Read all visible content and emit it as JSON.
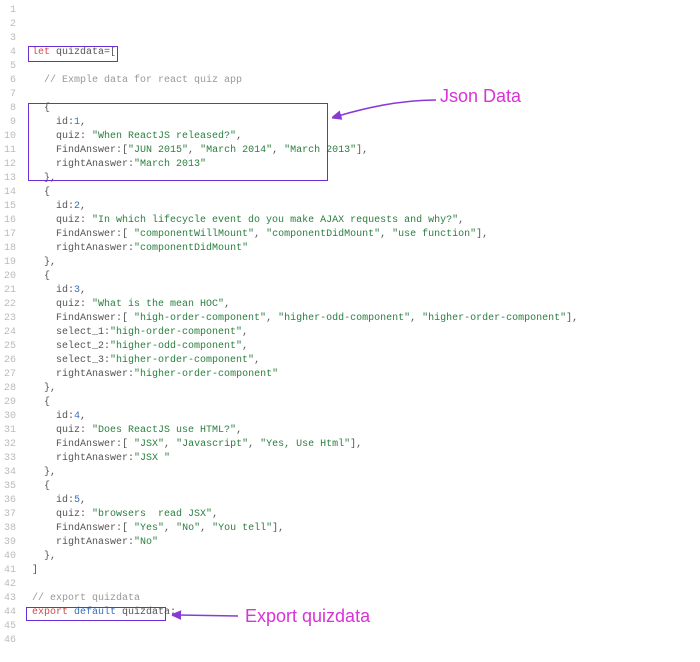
{
  "annotations": {
    "json_data": "Json Data",
    "export_quizdata": "Export quizdata"
  },
  "lines": [
    {
      "n": 1,
      "tokens": []
    },
    {
      "n": 2,
      "tokens": []
    },
    {
      "n": 3,
      "tokens": []
    },
    {
      "n": 4,
      "tokens": [
        [
          "kw-let",
          " let "
        ],
        [
          "ident",
          "quizdata"
        ],
        [
          "punct",
          "=["
        ]
      ]
    },
    {
      "n": 5,
      "tokens": []
    },
    {
      "n": 6,
      "tokens": [
        [
          "comment",
          "   // Exmple data for react quiz app"
        ]
      ]
    },
    {
      "n": 7,
      "tokens": []
    },
    {
      "n": 8,
      "tokens": [
        [
          "punct",
          "   {"
        ]
      ]
    },
    {
      "n": 9,
      "tokens": [
        [
          "prop",
          "     id"
        ],
        [
          "punct",
          ":"
        ],
        [
          "num",
          "1"
        ],
        [
          "punct",
          ","
        ]
      ]
    },
    {
      "n": 10,
      "tokens": [
        [
          "prop",
          "     quiz"
        ],
        [
          "punct",
          ": "
        ],
        [
          "str",
          "\"When ReactJS released?\""
        ],
        [
          "punct",
          ","
        ]
      ]
    },
    {
      "n": 11,
      "tokens": [
        [
          "prop",
          "     FindAnswer"
        ],
        [
          "punct",
          ":["
        ],
        [
          "str",
          "\"JUN 2015\""
        ],
        [
          "punct",
          ", "
        ],
        [
          "str",
          "\"March 2014\""
        ],
        [
          "punct",
          ", "
        ],
        [
          "str",
          "\"March 2013\""
        ],
        [
          "punct",
          "],"
        ]
      ]
    },
    {
      "n": 12,
      "tokens": [
        [
          "prop",
          "     rightAnaswer"
        ],
        [
          "punct",
          ":"
        ],
        [
          "str",
          "\"March 2013\""
        ]
      ]
    },
    {
      "n": 13,
      "tokens": [
        [
          "punct",
          "   },"
        ]
      ]
    },
    {
      "n": 14,
      "tokens": [
        [
          "punct",
          "   {"
        ]
      ]
    },
    {
      "n": 15,
      "tokens": [
        [
          "prop",
          "     id"
        ],
        [
          "punct",
          ":"
        ],
        [
          "num",
          "2"
        ],
        [
          "punct",
          ","
        ]
      ]
    },
    {
      "n": 16,
      "tokens": [
        [
          "prop",
          "     quiz"
        ],
        [
          "punct",
          ": "
        ],
        [
          "str",
          "\"In which lifecycle event do you make AJAX requests and why?\""
        ],
        [
          "punct",
          ","
        ]
      ]
    },
    {
      "n": 17,
      "tokens": [
        [
          "prop",
          "     FindAnswer"
        ],
        [
          "punct",
          ":[ "
        ],
        [
          "str",
          "\"componentWillMount\""
        ],
        [
          "punct",
          ", "
        ],
        [
          "str",
          "\"componentDidMount\""
        ],
        [
          "punct",
          ", "
        ],
        [
          "str",
          "\"use function\""
        ],
        [
          "punct",
          "],"
        ]
      ]
    },
    {
      "n": 18,
      "tokens": [
        [
          "prop",
          "     rightAnaswer"
        ],
        [
          "punct",
          ":"
        ],
        [
          "str",
          "\"componentDidMount\""
        ]
      ]
    },
    {
      "n": 19,
      "tokens": [
        [
          "punct",
          "   },"
        ]
      ]
    },
    {
      "n": 20,
      "tokens": [
        [
          "punct",
          "   {"
        ]
      ]
    },
    {
      "n": 21,
      "tokens": [
        [
          "prop",
          "     id"
        ],
        [
          "punct",
          ":"
        ],
        [
          "num",
          "3"
        ],
        [
          "punct",
          ","
        ]
      ]
    },
    {
      "n": 22,
      "tokens": [
        [
          "prop",
          "     quiz"
        ],
        [
          "punct",
          ": "
        ],
        [
          "str",
          "\"What is the mean HOC\""
        ],
        [
          "punct",
          ","
        ]
      ]
    },
    {
      "n": 23,
      "tokens": [
        [
          "prop",
          "     FindAnswer"
        ],
        [
          "punct",
          ":[ "
        ],
        [
          "str",
          "\"high-order-component\""
        ],
        [
          "punct",
          ", "
        ],
        [
          "str",
          "\"higher-odd-component\""
        ],
        [
          "punct",
          ", "
        ],
        [
          "str",
          "\"higher-order-component\""
        ],
        [
          "punct",
          "],"
        ]
      ]
    },
    {
      "n": 24,
      "tokens": [
        [
          "prop",
          "     select_1"
        ],
        [
          "punct",
          ":"
        ],
        [
          "str",
          "\"high-order-component\""
        ],
        [
          "punct",
          ","
        ]
      ]
    },
    {
      "n": 25,
      "tokens": [
        [
          "prop",
          "     select_2"
        ],
        [
          "punct",
          ":"
        ],
        [
          "str",
          "\"higher-odd-component\""
        ],
        [
          "punct",
          ","
        ]
      ]
    },
    {
      "n": 26,
      "tokens": [
        [
          "prop",
          "     select_3"
        ],
        [
          "punct",
          ":"
        ],
        [
          "str",
          "\"higher-order-component\""
        ],
        [
          "punct",
          ","
        ]
      ]
    },
    {
      "n": 27,
      "tokens": [
        [
          "prop",
          "     rightAnaswer"
        ],
        [
          "punct",
          ":"
        ],
        [
          "str",
          "\"higher-order-component\""
        ]
      ]
    },
    {
      "n": 28,
      "tokens": [
        [
          "punct",
          "   },"
        ]
      ]
    },
    {
      "n": 29,
      "tokens": [
        [
          "punct",
          "   {"
        ]
      ]
    },
    {
      "n": 30,
      "tokens": [
        [
          "prop",
          "     id"
        ],
        [
          "punct",
          ":"
        ],
        [
          "num",
          "4"
        ],
        [
          "punct",
          ","
        ]
      ]
    },
    {
      "n": 31,
      "tokens": [
        [
          "prop",
          "     quiz"
        ],
        [
          "punct",
          ": "
        ],
        [
          "str",
          "\"Does ReactJS use HTML?\""
        ],
        [
          "punct",
          ","
        ]
      ]
    },
    {
      "n": 32,
      "tokens": [
        [
          "prop",
          "     FindAnswer"
        ],
        [
          "punct",
          ":[ "
        ],
        [
          "str",
          "\"JSX\""
        ],
        [
          "punct",
          ", "
        ],
        [
          "str",
          "\"Javascript\""
        ],
        [
          "punct",
          ", "
        ],
        [
          "str",
          "\"Yes, Use Html\""
        ],
        [
          "punct",
          "],"
        ]
      ]
    },
    {
      "n": 33,
      "tokens": [
        [
          "prop",
          "     rightAnaswer"
        ],
        [
          "punct",
          ":"
        ],
        [
          "str",
          "\"JSX \""
        ]
      ]
    },
    {
      "n": 34,
      "tokens": [
        [
          "punct",
          "   },"
        ]
      ]
    },
    {
      "n": 35,
      "tokens": [
        [
          "punct",
          "   {"
        ]
      ]
    },
    {
      "n": 36,
      "tokens": [
        [
          "prop",
          "     id"
        ],
        [
          "punct",
          ":"
        ],
        [
          "num",
          "5"
        ],
        [
          "punct",
          ","
        ]
      ]
    },
    {
      "n": 37,
      "tokens": [
        [
          "prop",
          "     quiz"
        ],
        [
          "punct",
          ": "
        ],
        [
          "str",
          "\"browsers  read JSX\""
        ],
        [
          "punct",
          ","
        ]
      ]
    },
    {
      "n": 38,
      "tokens": [
        [
          "prop",
          "     FindAnswer"
        ],
        [
          "punct",
          ":[ "
        ],
        [
          "str",
          "\"Yes\""
        ],
        [
          "punct",
          ", "
        ],
        [
          "str",
          "\"No\""
        ],
        [
          "punct",
          ", "
        ],
        [
          "str",
          "\"You tell\""
        ],
        [
          "punct",
          "],"
        ]
      ]
    },
    {
      "n": 39,
      "tokens": [
        [
          "prop",
          "     rightAnaswer"
        ],
        [
          "punct",
          ":"
        ],
        [
          "str",
          "\"No\""
        ]
      ]
    },
    {
      "n": 40,
      "tokens": [
        [
          "punct",
          "   },"
        ]
      ]
    },
    {
      "n": 41,
      "tokens": [
        [
          "punct",
          " ]"
        ]
      ]
    },
    {
      "n": 42,
      "tokens": []
    },
    {
      "n": 43,
      "tokens": [
        [
          "comment",
          " // export quizdata"
        ]
      ]
    },
    {
      "n": 44,
      "tokens": [
        [
          "kw-export",
          " export "
        ],
        [
          "kw-default",
          "default "
        ],
        [
          "ident",
          "quizdata"
        ],
        [
          "punct",
          ";"
        ]
      ]
    },
    {
      "n": 45,
      "tokens": []
    },
    {
      "n": 46,
      "tokens": []
    }
  ]
}
